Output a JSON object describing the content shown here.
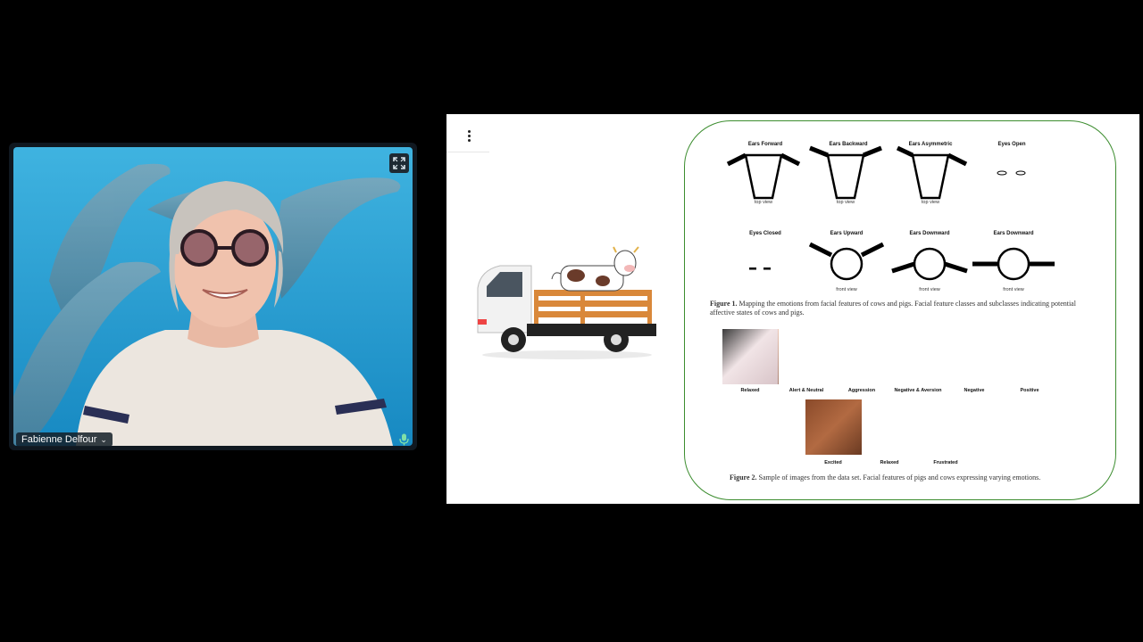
{
  "participant": {
    "name": "Fabienne Delfour",
    "name_chevron": "⌄"
  },
  "slide": {
    "figure1": {
      "labels": [
        "Ears Forward",
        "Ears Backward",
        "Ears Asymmetric",
        "Eyes Open",
        "Eyes Closed",
        "Ears Upward",
        "Ears Downward",
        "Ears Downward"
      ],
      "view_labels": [
        "top view",
        "top view",
        "top view",
        "front view",
        "front view",
        "front view"
      ],
      "caption_bold": "Figure 1.",
      "caption": " Mapping the emotions from facial features of cows and pigs. Facial feature classes and subclasses indicating potential affective states of cows and pigs."
    },
    "figure2": {
      "pig_labels": [
        "Relaxed",
        "Alert & Neutral",
        "Aggression",
        "Negative & Aversion",
        "Negative",
        "Positive"
      ],
      "cow_labels": [
        "Excited",
        "Relaxed",
        "Frustrated"
      ],
      "caption_bold": "Figure 2.",
      "caption": " Sample of images from the data set. Facial features of pigs and cows expressing varying emotions."
    },
    "colors": {
      "panel_border": "#3c8d2f",
      "truck_cab": "#f2f2f2",
      "truck_bed_wood": "#d9883a"
    }
  },
  "icons": {
    "expand": "expand-icon",
    "mic": "mic-icon",
    "menu": "kebab-menu-icon"
  }
}
